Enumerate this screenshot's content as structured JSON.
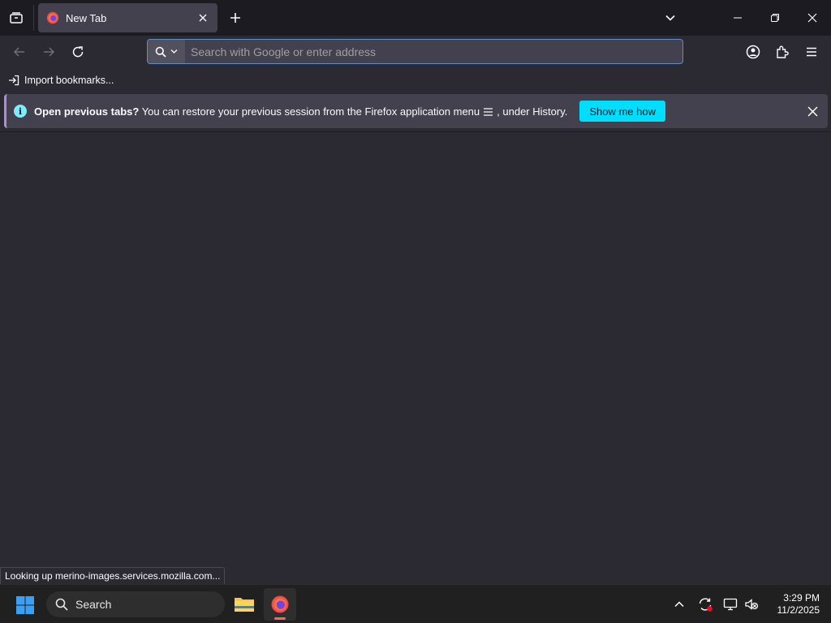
{
  "window": {
    "tab_title": "New Tab"
  },
  "urlbar": {
    "placeholder": "Search with Google or enter address",
    "value": ""
  },
  "bookmarks": {
    "import_label": "Import bookmarks..."
  },
  "notification": {
    "title": "Open previous tabs?",
    "message_before": " You can restore your previous session from the Firefox application menu",
    "message_after": ", under History.",
    "button_label": "Show me how"
  },
  "status_text": "Looking up merino-images.services.mozilla.com...",
  "taskbar": {
    "search_label": "Search",
    "time": "3:29 PM",
    "date": "11/2/2025"
  },
  "colors": {
    "accent": "#00ddff",
    "urlbar_focus": "#5f8fc7",
    "notification_stripe": "#b08bdc",
    "background": "#2b2a33"
  },
  "icons": [
    "tab-list-icon",
    "firefox-icon",
    "close-icon",
    "plus-icon",
    "chevron-down-icon",
    "minimize-icon",
    "restore-icon",
    "back-icon",
    "forward-icon",
    "reload-icon",
    "search-icon",
    "account-icon",
    "extensions-icon",
    "hamburger-menu-icon",
    "import-icon",
    "info-icon",
    "windows-start-icon",
    "file-explorer-icon",
    "sync-icon",
    "network-icon",
    "volume-muted-icon"
  ]
}
